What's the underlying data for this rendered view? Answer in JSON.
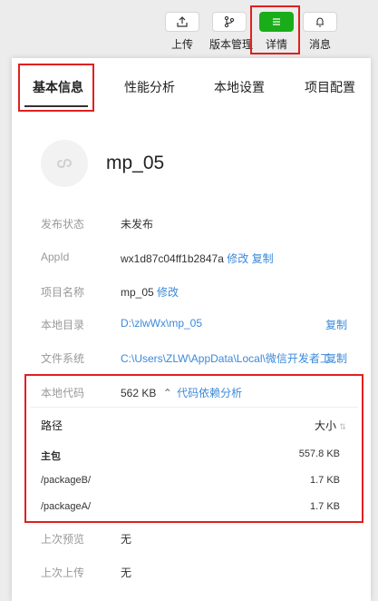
{
  "toolbar": {
    "upload_label": "上传",
    "version_label": "版本管理",
    "details_label": "详情",
    "messages_label": "消息"
  },
  "tabs": [
    "基本信息",
    "性能分析",
    "本地设置",
    "项目配置"
  ],
  "app": {
    "name": "mp_05"
  },
  "info": {
    "status_label": "发布状态",
    "status_value": "未发布",
    "appid_label": "AppId",
    "appid_value": "wx1d87c04ff1b2847a",
    "appid_edit": "修改",
    "appid_copy": "复制",
    "project_label": "项目名称",
    "project_value": "mp_05",
    "project_edit": "修改",
    "localdir_label": "本地目录",
    "localdir_value": "D:\\zlwWx\\mp_05",
    "localdir_copy": "复制",
    "fs_label": "文件系统",
    "fs_value": "C:\\Users\\ZLW\\AppData\\Local\\微信开发者工...",
    "fs_copy": "复制",
    "code_label": "本地代码",
    "code_size": "562 KB",
    "code_dep_link": "代码依赖分析",
    "last_preview_label": "上次预览",
    "last_preview_value": "无",
    "last_upload_label": "上次上传",
    "last_upload_value": "无"
  },
  "packages": {
    "col_path": "路径",
    "col_size": "大小",
    "rows": [
      {
        "path": "主包",
        "size": "557.8 KB"
      },
      {
        "path": "/packageB/",
        "size": "1.7 KB"
      },
      {
        "path": "/packageA/",
        "size": "1.7 KB"
      }
    ]
  },
  "colors": {
    "accent_green": "#1aad19",
    "link_blue": "#3b8ad9",
    "highlight_red": "#e02020"
  }
}
